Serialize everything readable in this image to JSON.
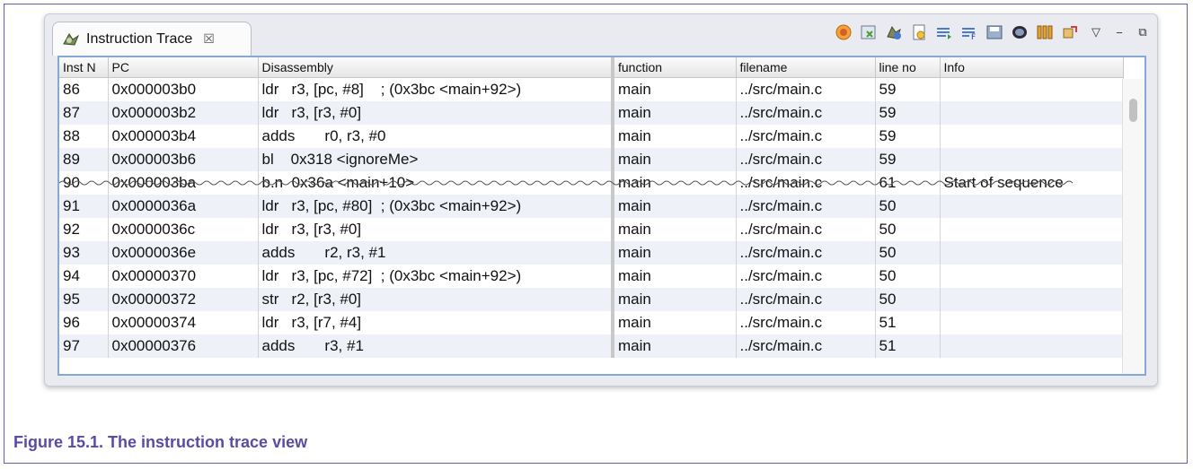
{
  "view": {
    "tab_title": "Instruction Trace",
    "tab_close": "☒"
  },
  "toolbar": {
    "icons": [
      "refresh-trace-icon",
      "config-icon",
      "capture-icon",
      "export-icon",
      "filter-icon",
      "format-icon",
      "save-icon",
      "stop-icon",
      "columns-icon",
      "link-icon"
    ],
    "view_menu": "▽",
    "minimize": "−",
    "restore": "⧉"
  },
  "table": {
    "headers": [
      "Inst N",
      "PC",
      "Disassembly",
      "function",
      "filename",
      "line no",
      "Info"
    ],
    "rows": [
      {
        "n": "86",
        "pc": "0x000003b0",
        "dis": "ldr   r3, [pc, #8]    ; (0x3bc <main+92>)",
        "fn": "main",
        "file": "../src/main.c",
        "line": "59",
        "info": ""
      },
      {
        "n": "87",
        "pc": "0x000003b2",
        "dis": "ldr   r3, [r3, #0]",
        "fn": "main",
        "file": "../src/main.c",
        "line": "59",
        "info": ""
      },
      {
        "n": "88",
        "pc": "0x000003b4",
        "dis": "adds       r0, r3, #0",
        "fn": "main",
        "file": "../src/main.c",
        "line": "59",
        "info": ""
      },
      {
        "n": "89",
        "pc": "0x000003b6",
        "dis": "bl    0x318 <ignoreMe>",
        "fn": "main",
        "file": "../src/main.c",
        "line": "59",
        "info": ""
      },
      {
        "n": "90",
        "pc": "0x000003ba",
        "dis": "b.n  0x36a <main+10>",
        "fn": "main",
        "file": "../src/main.c",
        "line": "61",
        "info": "Start of sequence"
      },
      {
        "n": "91",
        "pc": "0x0000036a",
        "dis": "ldr   r3, [pc, #80]  ; (0x3bc <main+92>)",
        "fn": "main",
        "file": "../src/main.c",
        "line": "50",
        "info": ""
      },
      {
        "n": "92",
        "pc": "0x0000036c",
        "dis": "ldr   r3, [r3, #0]",
        "fn": "main",
        "file": "../src/main.c",
        "line": "50",
        "info": ""
      },
      {
        "n": "93",
        "pc": "0x0000036e",
        "dis": "adds       r2, r3, #1",
        "fn": "main",
        "file": "../src/main.c",
        "line": "50",
        "info": ""
      },
      {
        "n": "94",
        "pc": "0x00000370",
        "dis": "ldr   r3, [pc, #72]  ; (0x3bc <main+92>)",
        "fn": "main",
        "file": "../src/main.c",
        "line": "50",
        "info": ""
      },
      {
        "n": "95",
        "pc": "0x00000372",
        "dis": "str   r2, [r3, #0]",
        "fn": "main",
        "file": "../src/main.c",
        "line": "50",
        "info": ""
      },
      {
        "n": "96",
        "pc": "0x00000374",
        "dis": "ldr   r3, [r7, #4]",
        "fn": "main",
        "file": "../src/main.c",
        "line": "51",
        "info": ""
      },
      {
        "n": "97",
        "pc": "0x00000376",
        "dis": "adds       r3, #1",
        "fn": "main",
        "file": "../src/main.c",
        "line": "51",
        "info": ""
      }
    ]
  },
  "caption": "Figure 15.1. The instruction trace view",
  "colors": {
    "caption": "#5a4ba6",
    "selection_border": "#86a9d4"
  }
}
